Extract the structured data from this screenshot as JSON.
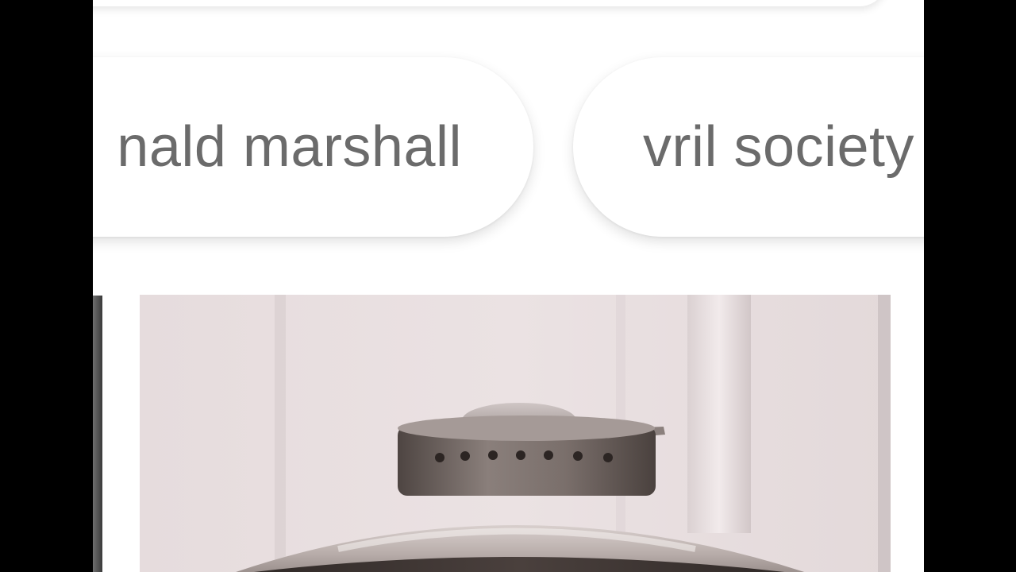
{
  "search_chips": [
    {
      "label": "nald marshall"
    },
    {
      "label": "vril society"
    }
  ],
  "image_results": [
    {
      "subject": "black-and-white photograph of a saucer-shaped metal craft model"
    }
  ],
  "colors": {
    "background_frame": "#000000",
    "page_background": "#ffffff",
    "chip_text": "#6b6b6b",
    "photo_tone": "#e2d8d9"
  }
}
